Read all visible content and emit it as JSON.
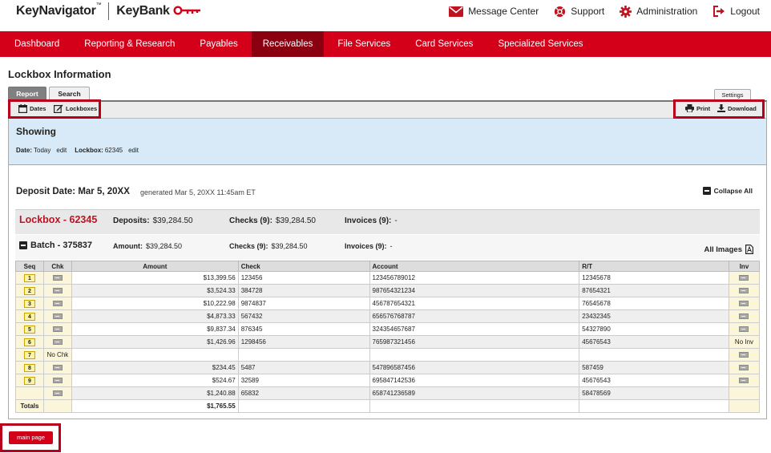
{
  "header": {
    "brand_primary": "KeyNavigator",
    "brand_tm": "™",
    "brand_secondary": "KeyBank",
    "links": [
      {
        "label": "Message Center",
        "icon": "envelope-icon"
      },
      {
        "label": "Support",
        "icon": "lifebuoy-icon"
      },
      {
        "label": "Administration",
        "icon": "gear-icon"
      },
      {
        "label": "Logout",
        "icon": "logout-icon"
      }
    ]
  },
  "nav": {
    "items": [
      "Dashboard",
      "Reporting & Research",
      "Payables",
      "Receivables",
      "File Services",
      "Card Services",
      "Specialized Services"
    ],
    "active": "Receivables"
  },
  "page": {
    "title": "Lockbox Information"
  },
  "tabs": {
    "report": "Report",
    "search": "Search",
    "settings": "Settings"
  },
  "toolbar": {
    "dates": "Dates",
    "lockboxes": "Lockboxes",
    "print": "Print",
    "download": "Download"
  },
  "showing": {
    "title": "Showing",
    "date_label": "Date:",
    "date_value": "Today",
    "lockbox_label": "Lockbox:",
    "lockbox_value": "62345",
    "edit": "edit"
  },
  "deposit": {
    "date": "Deposit Date: Mar 5, 20XX",
    "generated": "generated Mar 5, 20XX 11:45am ET",
    "collapse_all": "Collapse All"
  },
  "lockbox": {
    "title": "Lockbox - 62345",
    "deposits_label": "Deposits:",
    "deposits_value": "$39,284.50",
    "checks_label": "Checks (9):",
    "checks_value": "$39,284.50",
    "invoices_label": "Invoices (9):",
    "invoices_value": "-"
  },
  "batch": {
    "title": "Batch - 375837",
    "amount_label": "Amount:",
    "amount_value": "$39,284.50",
    "checks_label": "Checks (9):",
    "checks_value": "$39,284.50",
    "invoices_label": "Invoices (9):",
    "invoices_value": "-",
    "all_images": "All Images"
  },
  "table": {
    "headers": {
      "seq": "Seq",
      "chk": "Chk",
      "amount": "Amount",
      "check": "Check",
      "account": "Account",
      "rt": "R/T",
      "inv": "Inv"
    },
    "rows": [
      {
        "seq": "1",
        "chk": "img",
        "amount": "$13,399.56",
        "check": "123456",
        "account": "123456789012",
        "rt": "12345678",
        "inv": "img"
      },
      {
        "seq": "2",
        "chk": "img",
        "amount": "$3,524.33",
        "check": "384728",
        "account": "987654321234",
        "rt": "87654321",
        "inv": "img"
      },
      {
        "seq": "3",
        "chk": "img",
        "amount": "$10,222.98",
        "check": "9874837",
        "account": "456787654321",
        "rt": "76545678",
        "inv": "img"
      },
      {
        "seq": "4",
        "chk": "img",
        "amount": "$4,873.33",
        "check": "567432",
        "account": "656576768787",
        "rt": "23432345",
        "inv": "img"
      },
      {
        "seq": "5",
        "chk": "img",
        "amount": "$9,837.34",
        "check": "876345",
        "account": "324354657687",
        "rt": "54327890",
        "inv": "img"
      },
      {
        "seq": "6",
        "chk": "img",
        "amount": "$1,426.96",
        "check": "1298456",
        "account": "765987321456",
        "rt": "45676543",
        "inv": "No Inv"
      },
      {
        "seq": "7",
        "chk": "No Chk",
        "amount": "",
        "check": "",
        "account": "",
        "rt": "",
        "inv": "img"
      },
      {
        "seq": "8",
        "chk": "img",
        "amount": "$234.45",
        "check": "5487",
        "account": "547896587456",
        "rt": "587459",
        "inv": "img"
      },
      {
        "seq": "9",
        "chk": "img",
        "amount": "$524.67",
        "check": "32589",
        "account": "695847142536",
        "rt": "45676543",
        "inv": "img"
      },
      {
        "seq": "",
        "chk": "img",
        "amount": "$1,240.88",
        "check": "65832",
        "account": "658741236589",
        "rt": "58478569",
        "inv": ""
      }
    ],
    "totals_label": "Totals",
    "totals_amount": "$1,765.55"
  },
  "footer": {
    "main_page": "main page"
  },
  "colors": {
    "brand_red": "#d4001a",
    "nav_active": "#8b0010",
    "showing_bg": "#d8eaf7",
    "highlight_border": "#b8001a"
  }
}
